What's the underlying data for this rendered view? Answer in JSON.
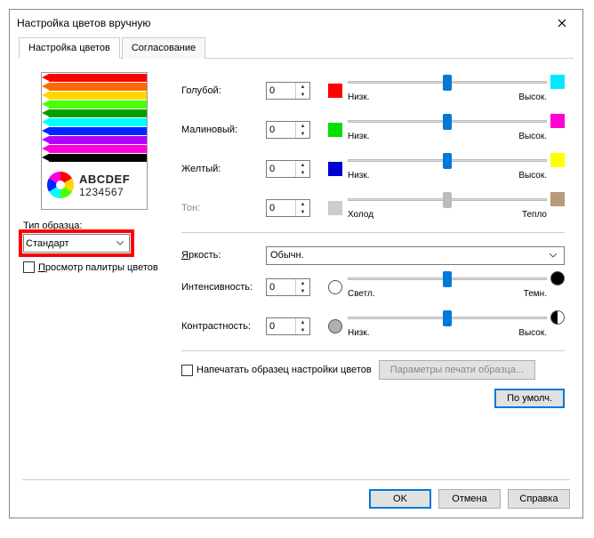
{
  "title": "Настройка цветов вручную",
  "tabs": {
    "color": "Настройка цветов",
    "match": "Согласование"
  },
  "preview": {
    "abc": "ABCDEF",
    "nums": "1234567"
  },
  "sample": {
    "label": "Тип образца:",
    "value": "Стандарт"
  },
  "palette_checkbox": "Просмотр палитры цветов",
  "rows": {
    "cyan": {
      "label": "Голубой:",
      "value": "0",
      "low": "Низк.",
      "high": "Высок.",
      "left_color": "#ff0000",
      "right_color": "#00eaff"
    },
    "magenta": {
      "label": "Малиновый:",
      "value": "0",
      "low": "Низк.",
      "high": "Высок.",
      "left_color": "#00e000",
      "right_color": "#ff00d0"
    },
    "yellow": {
      "label": "Желтый:",
      "value": "0",
      "low": "Низк.",
      "high": "Высок.",
      "left_color": "#0000d0",
      "right_color": "#ffff00"
    },
    "tone": {
      "label": "Тон:",
      "value": "0",
      "low": "Холод",
      "high": "Тепло"
    },
    "intensity": {
      "label": "Интенсивность:",
      "value": "0",
      "low": "Светл.",
      "high": "Темн."
    },
    "contrast": {
      "label": "Контрастность:",
      "value": "0",
      "low": "Низк.",
      "high": "Высок."
    }
  },
  "brightness": {
    "label": "Яркость:",
    "value": "Обычн."
  },
  "print_sample_checkbox": "Напечатать образец настройки цветов",
  "print_params_btn": "Параметры печати образца...",
  "default_btn": "По умолч.",
  "dlg_btns": {
    "ok": "OK",
    "cancel": "Отмена",
    "help": "Справка"
  },
  "pencils": [
    "#ff0000",
    "#ff6a00",
    "#ffd800",
    "#4cff00",
    "#00a000",
    "#00ffff",
    "#0026ff",
    "#b200ff",
    "#ff00dc",
    "#000000"
  ]
}
